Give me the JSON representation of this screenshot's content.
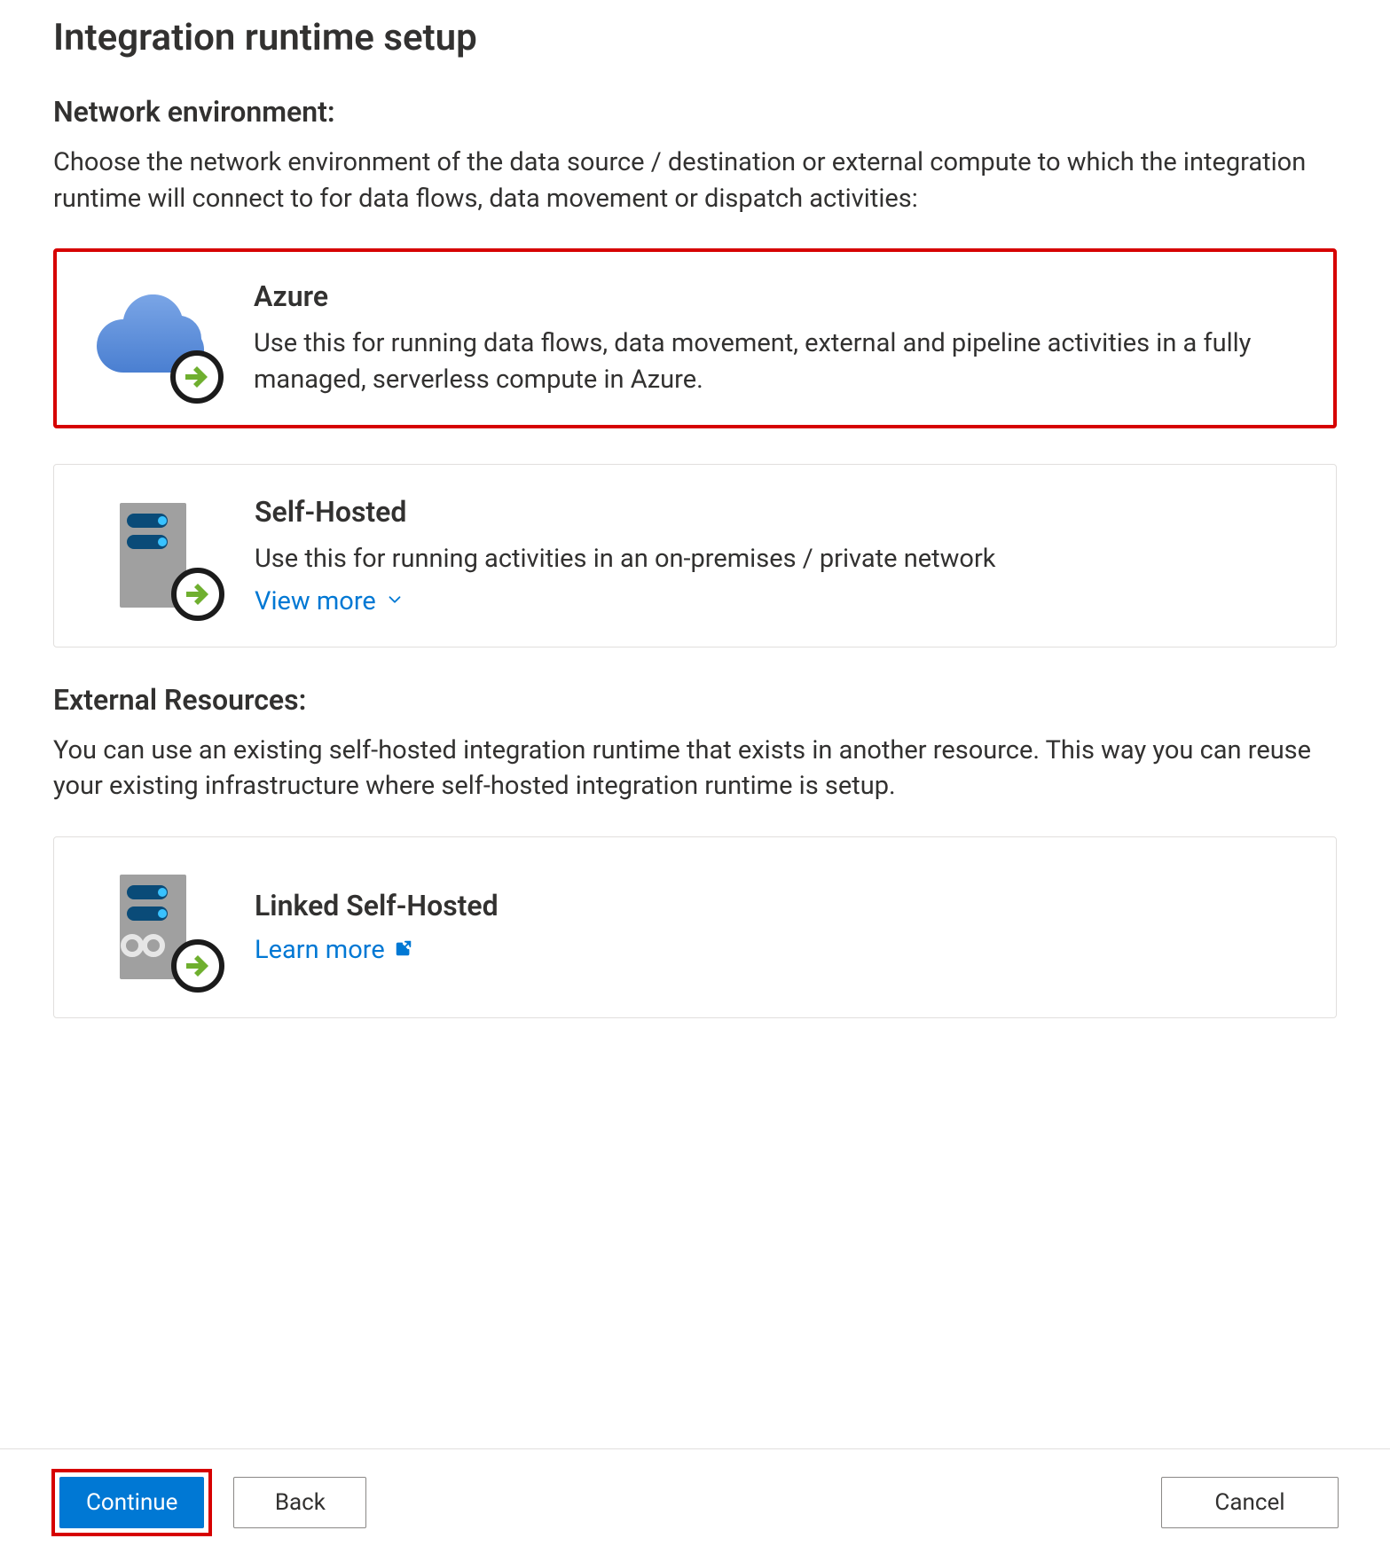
{
  "title": "Integration runtime setup",
  "network_section": {
    "heading": "Network environment:",
    "body": "Choose the network environment of the data source / destination or external compute to which the integration runtime will connect to for data flows, data movement or dispatch activities:"
  },
  "options": {
    "azure": {
      "title": "Azure",
      "desc": "Use this for running data flows, data movement, external and pipeline activities in a fully managed, serverless compute in Azure."
    },
    "self_hosted": {
      "title": "Self-Hosted",
      "desc": "Use this for running activities in an on-premises / private network",
      "link": "View more"
    }
  },
  "external_section": {
    "heading": "External Resources:",
    "body": "You can use an existing self-hosted integration runtime that exists in another resource. This way you can reuse your existing infrastructure where self-hosted integration runtime is setup."
  },
  "linked_self_hosted": {
    "title": "Linked Self-Hosted",
    "link": "Learn more"
  },
  "buttons": {
    "continue": "Continue",
    "back": "Back",
    "cancel": "Cancel"
  }
}
